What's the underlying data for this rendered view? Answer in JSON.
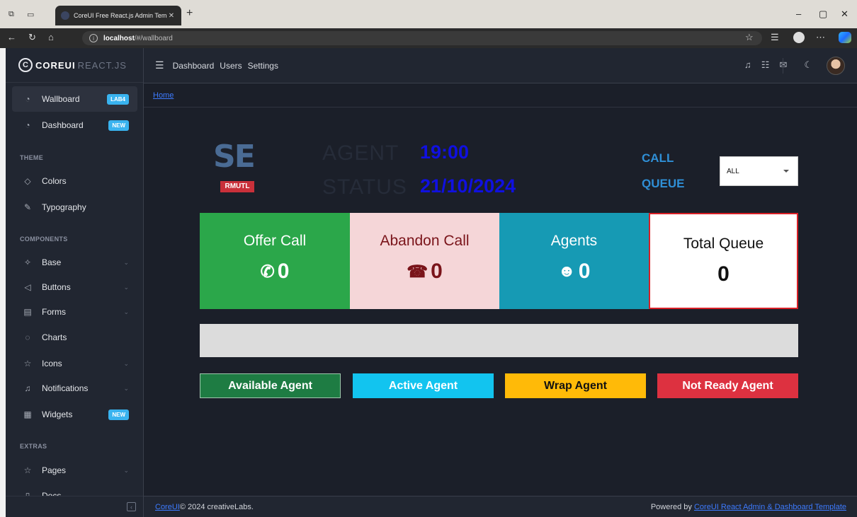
{
  "browser": {
    "tab_title": "CoreUI Free React.js Admin Temp",
    "url_host": "localhost",
    "url_path": "/#/wallboard"
  },
  "sidebar": {
    "brand": "COREUI",
    "brand_sub": "REACT.JS",
    "items": [
      {
        "label": "Wallboard",
        "badge": "LAB4"
      },
      {
        "label": "Dashboard",
        "badge": "NEW"
      },
      {
        "label": "Colors"
      },
      {
        "label": "Typography"
      },
      {
        "label": "Base"
      },
      {
        "label": "Buttons"
      },
      {
        "label": "Forms"
      },
      {
        "label": "Charts"
      },
      {
        "label": "Icons"
      },
      {
        "label": "Notifications"
      },
      {
        "label": "Widgets",
        "badge": "NEW"
      },
      {
        "label": "Pages"
      },
      {
        "label": "Docs"
      }
    ],
    "sections": [
      "THEME",
      "COMPONENTS",
      "EXTRAS"
    ]
  },
  "header": {
    "nav": [
      "Dashboard",
      "Users",
      "Settings"
    ]
  },
  "breadcrumb": {
    "home": "Home"
  },
  "wallboard": {
    "logo_text": "SE",
    "logo_sub": "RMUTL",
    "agent_label": "AGENT",
    "status_label": "STATUS",
    "time": "19:00",
    "date": "21/10/2024",
    "call_label": "CALL",
    "queue_label": "QUEUE",
    "queue_select": "ALL",
    "cards": {
      "offer": {
        "title": "Offer Call",
        "value": "0"
      },
      "abandon": {
        "title": "Abandon Call",
        "value": "0"
      },
      "agents": {
        "title": "Agents",
        "value": "0"
      },
      "total": {
        "title": "Total Queue",
        "value": "0"
      }
    },
    "legend": {
      "available": "Available Agent",
      "active": "Active Agent",
      "wrap": "Wrap Agent",
      "notready": "Not Ready Agent"
    }
  },
  "footer": {
    "left_link": "CoreUI",
    "left_text": " © 2024 creativeLabs.",
    "right_text": "Powered by ",
    "right_link": "CoreUI React Admin & Dashboard Template"
  },
  "colors": {
    "offer": "#2ba74a",
    "abandon": "#f5d6d8",
    "agents": "#169ab4",
    "total_border": "#d91f26",
    "clock": "#1010e0"
  }
}
